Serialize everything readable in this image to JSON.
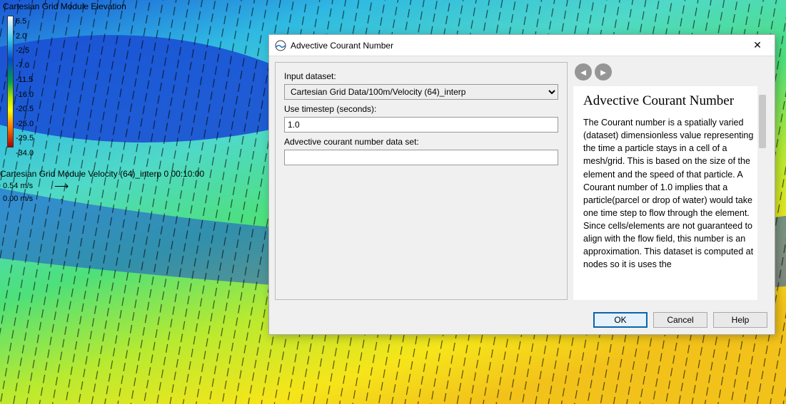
{
  "map": {
    "elevation_legend_title": "Cartesian Grid Module Elevation",
    "colorbar_ticks": [
      "6.5",
      "2.0",
      "-2.5",
      "-7.0",
      "-11.5",
      "-16.0",
      "-20.5",
      "-25.0",
      "-29.5",
      "-34.0"
    ],
    "velocity_legend_title": "Cartesian Grid Module Velocity (64)_interp 0 00:10:00",
    "velocity_scale_1": "0.54 m/s",
    "velocity_scale_2": "0.00 m/s"
  },
  "dialog": {
    "title": "Advective Courant Number",
    "close_glyph": "✕",
    "left": {
      "input_dataset_label": "Input dataset:",
      "input_dataset_value": "Cartesian Grid Data/100m/Velocity (64)_interp",
      "timestep_label": "Use timestep (seconds):",
      "timestep_value": "1.0",
      "output_dataset_label": "Advective courant number data set:",
      "output_dataset_value": ""
    },
    "help": {
      "nav_back_glyph": "◄",
      "nav_fwd_glyph": "►",
      "heading": "Advective Courant Number",
      "body": "The Courant number is a spatially varied (dataset) dimensionless value representing the time a particle stays in a cell of a mesh/grid. This is based on the size of the element and the speed of that particle. A Courant number of 1.0 implies that a particle(parcel or drop of water) would take one time step to flow through the element. Since cells/elements are not guaranteed to align with the flow field, this number is an approximation. This dataset is computed at nodes so it is uses the"
    },
    "buttons": {
      "ok": "OK",
      "cancel": "Cancel",
      "help": "Help"
    }
  }
}
